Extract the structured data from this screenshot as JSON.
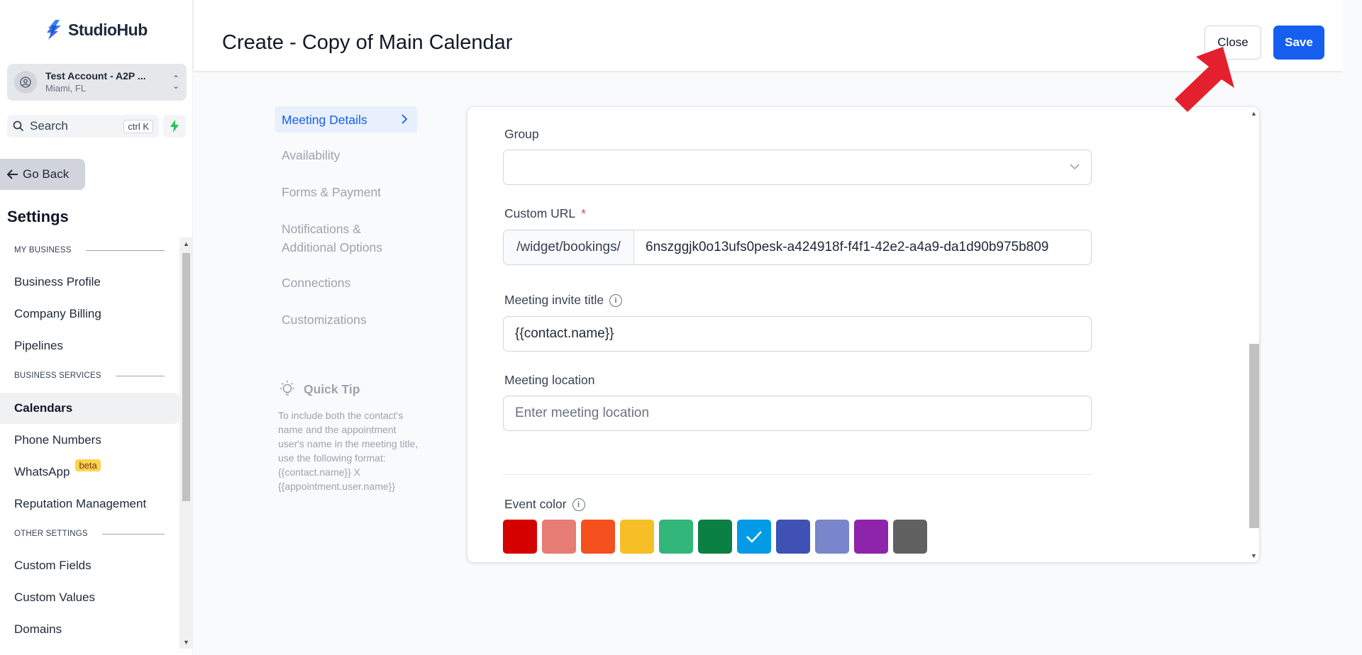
{
  "app": {
    "brand": "StudioHub"
  },
  "account": {
    "name": "Test Account - A2P ...",
    "location": "Miami, FL"
  },
  "search": {
    "label": "Search",
    "shortcut": "ctrl K"
  },
  "nav": {
    "go_back": "Go Back",
    "settings_title": "Settings"
  },
  "sidebar": {
    "sections": [
      {
        "title": "MY BUSINESS"
      },
      {
        "title": "BUSINESS SERVICES"
      },
      {
        "title": "OTHER SETTINGS"
      }
    ],
    "items": [
      {
        "label": "Business Profile"
      },
      {
        "label": "Company Billing"
      },
      {
        "label": "Pipelines"
      },
      {
        "label": "Calendars",
        "active": true
      },
      {
        "label": "Phone Numbers"
      },
      {
        "label": "WhatsApp",
        "badge": "beta"
      },
      {
        "label": "Reputation Management"
      },
      {
        "label": "Custom Fields"
      },
      {
        "label": "Custom Values"
      },
      {
        "label": "Domains"
      }
    ]
  },
  "header": {
    "title": "Create - Copy of Main Calendar",
    "close_label": "Close",
    "save_label": "Save"
  },
  "steps": [
    {
      "label": "Meeting Details",
      "active": true
    },
    {
      "label": "Availability"
    },
    {
      "label": "Forms & Payment"
    },
    {
      "label": "Notifications & Additional Options"
    },
    {
      "label": "Connections"
    },
    {
      "label": "Customizations"
    }
  ],
  "quick_tip": {
    "title": "Quick Tip",
    "body": "To include both the contact's name and the appointment user's name in the meeting title, use the following format: {{contact.name}} X {{appointment.user.name}}"
  },
  "form": {
    "group": {
      "label": "Group",
      "value": ""
    },
    "custom_url": {
      "label": "Custom URL",
      "required_mark": "*",
      "prefix": "/widget/bookings/",
      "value": "6nszggjk0o13ufs0pesk-a424918f-f4f1-42e2-a4a9-da1d90b975b809"
    },
    "invite_title": {
      "label": "Meeting invite title",
      "value": "{{contact.name}}"
    },
    "location": {
      "label": "Meeting location",
      "placeholder": "Enter meeting location"
    },
    "event_color": {
      "label": "Event color",
      "colors": [
        "#d50000",
        "#e67c73",
        "#f4511e",
        "#f6bf26",
        "#33b679",
        "#0b8043",
        "#039be5",
        "#3f51b5",
        "#7986cb",
        "#8e24aa",
        "#616161"
      ],
      "selected": "#039be5"
    }
  },
  "accent_colors": {
    "primary": "#155eef",
    "annotation_arrow": "#e5202e"
  }
}
